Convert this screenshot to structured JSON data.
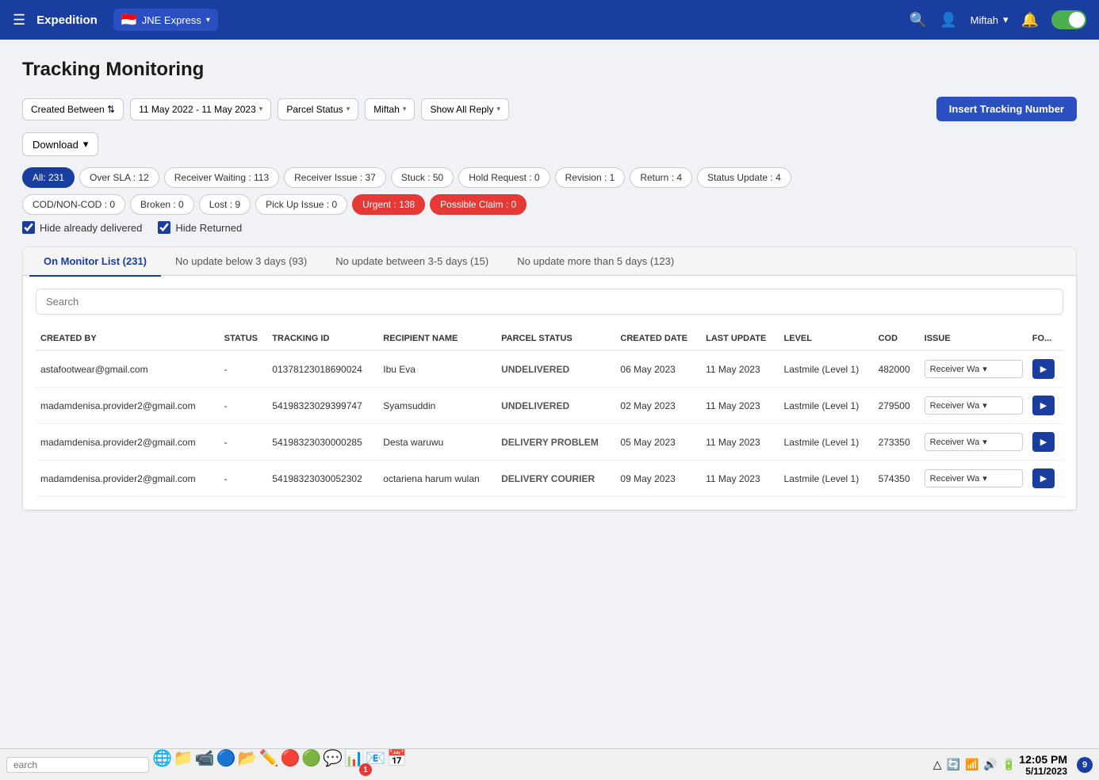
{
  "navbar": {
    "menu_icon": "☰",
    "title": "Expedition",
    "brand_flag": "🇮🇩",
    "brand_name": "JNE Express",
    "search_icon": "🔍",
    "user_name": "Miftah",
    "bell_icon": "🔔"
  },
  "page": {
    "title": "Tracking Monitoring"
  },
  "filters": {
    "created_between_label": "Created Between ⇅",
    "date_range": "11 May 2022 - 11 May 2023",
    "parcel_status_label": "Parcel Status",
    "user_label": "Miftah",
    "show_reply_label": "Show All Reply",
    "insert_button": "Insert Tracking Number"
  },
  "download": {
    "label": "Download"
  },
  "tags": [
    {
      "id": "all",
      "label": "All: 231",
      "active": true
    },
    {
      "id": "over-sla",
      "label": "Over SLA : 12",
      "active": false
    },
    {
      "id": "receiver-waiting",
      "label": "Receiver Waiting : 113",
      "active": false
    },
    {
      "id": "receiver-issue",
      "label": "Receiver Issue : 37",
      "active": false
    },
    {
      "id": "stuck",
      "label": "Stuck : 50",
      "active": false
    },
    {
      "id": "hold-request",
      "label": "Hold Request : 0",
      "active": false
    },
    {
      "id": "revision",
      "label": "Revision : 1",
      "active": false
    },
    {
      "id": "return",
      "label": "Return : 4",
      "active": false
    },
    {
      "id": "status-update",
      "label": "Status Update : 4",
      "active": false
    }
  ],
  "tags2": [
    {
      "id": "cod",
      "label": "COD/NON-COD : 0",
      "active": false
    },
    {
      "id": "broken",
      "label": "Broken : 0",
      "active": false
    },
    {
      "id": "lost",
      "label": "Lost : 9",
      "active": false
    },
    {
      "id": "pickup-issue",
      "label": "Pick Up Issue : 0",
      "active": false
    },
    {
      "id": "urgent",
      "label": "Urgent : 138",
      "type": "urgent"
    },
    {
      "id": "claim",
      "label": "Possible Claim : 0",
      "type": "claim"
    }
  ],
  "checkboxes": {
    "hide_delivered": "Hide already delivered",
    "hide_returned": "Hide Returned"
  },
  "tabs": [
    {
      "id": "monitor",
      "label": "On Monitor List (231)",
      "active": true
    },
    {
      "id": "no-update-3",
      "label": "No update below 3 days (93)",
      "active": false
    },
    {
      "id": "no-update-3-5",
      "label": "No update between 3-5 days (15)",
      "active": false
    },
    {
      "id": "no-update-5",
      "label": "No update more than 5 days (123)",
      "active": false
    }
  ],
  "table": {
    "search_placeholder": "Search",
    "columns": [
      "CREATED BY",
      "STATUS",
      "TRACKING ID",
      "RECIPIENT NAME",
      "PARCEL STATUS",
      "CREATED DATE",
      "LAST UPDATE",
      "LEVEL",
      "COD",
      "ISSUE",
      "FO..."
    ],
    "rows": [
      {
        "created_by": "astafootwear@gmail.com",
        "status": "-",
        "tracking_id": "01378123018690024",
        "recipient": "Ibu Eva",
        "parcel_status": "UNDELIVERED",
        "created_date": "06 May 2023",
        "last_update": "11 May 2023",
        "level": "Lastmile (Level 1)",
        "cod": "482000",
        "issue": "Receiver Wa"
      },
      {
        "created_by": "madamdenisa.provider2@gmail.com",
        "status": "-",
        "tracking_id": "54198323029399747",
        "recipient": "Syamsuddin",
        "parcel_status": "UNDELIVERED",
        "created_date": "02 May 2023",
        "last_update": "11 May 2023",
        "level": "Lastmile (Level 1)",
        "cod": "279500",
        "issue": "Receiver Wa"
      },
      {
        "created_by": "madamdenisa.provider2@gmail.com",
        "status": "-",
        "tracking_id": "54198323030000285",
        "recipient": "Desta waruwu",
        "parcel_status": "DELIVERY PROBLEM",
        "created_date": "05 May 2023",
        "last_update": "11 May 2023",
        "level": "Lastmile (Level 1)",
        "cod": "273350",
        "issue": "Receiver Wa"
      },
      {
        "created_by": "madamdenisa.provider2@gmail.com",
        "status": "-",
        "tracking_id": "54198323030052302",
        "recipient": "octariena harum wulan",
        "parcel_status": "DELIVERY COURIER",
        "created_date": "09 May 2023",
        "last_update": "11 May 2023",
        "level": "Lastmile (Level 1)",
        "cod": "574350",
        "issue": "Receiver Wa"
      }
    ]
  },
  "taskbar": {
    "search_placeholder": "earch",
    "time": "12:05 PM",
    "date": "5/11/2023",
    "notif_count": "1"
  }
}
